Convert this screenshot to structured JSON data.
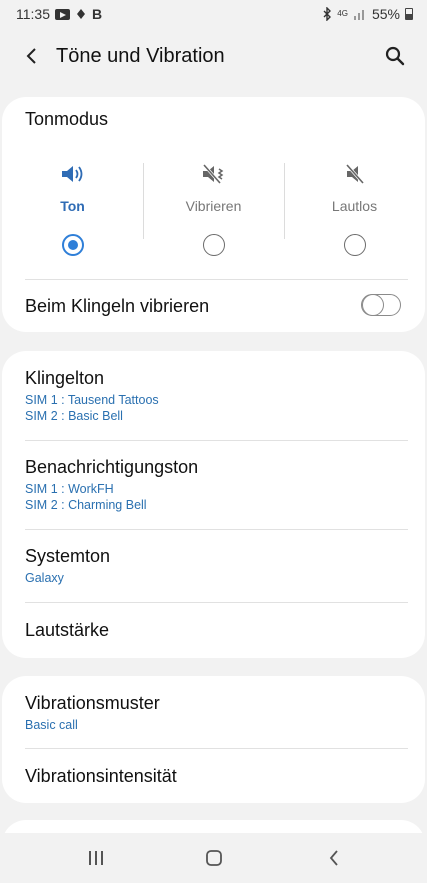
{
  "status_bar": {
    "time": "11:35",
    "notif_letter": "B",
    "network_label": "4G",
    "battery_percent": "55%"
  },
  "header": {
    "title": "Töne und Vibration"
  },
  "sound_mode": {
    "title": "Tonmodus",
    "options": [
      {
        "label": "Ton",
        "selected": true
      },
      {
        "label": "Vibrieren",
        "selected": false
      },
      {
        "label": "Lautlos",
        "selected": false
      }
    ],
    "vibrate_when_ringing": {
      "label": "Beim Klingeln vibrieren",
      "enabled": false
    }
  },
  "sounds": {
    "ringtone": {
      "title": "Klingelton",
      "sim1": "SIM 1 : Tausend Tattoos",
      "sim2": "SIM 2 : Basic Bell"
    },
    "notification": {
      "title": "Benachrichtigungston",
      "sim1": "SIM 1 : WorkFH",
      "sim2": "SIM 2 : Charming Bell"
    },
    "system": {
      "title": "Systemton",
      "value": "Galaxy"
    },
    "volume": {
      "title": "Lautstärke"
    }
  },
  "vibration": {
    "pattern": {
      "title": "Vibrationsmuster",
      "value": "Basic call"
    },
    "intensity": {
      "title": "Vibrationsintensität"
    }
  },
  "colors": {
    "accent": "#2f7fd8",
    "subtitle": "#2a70b0",
    "background": "#f2f2f2",
    "card": "#ffffff"
  },
  "icons": [
    "back-arrow-icon",
    "search-icon",
    "speaker-icon",
    "vibrate-icon",
    "mute-icon",
    "recents-icon",
    "home-icon",
    "nav-back-icon"
  ]
}
